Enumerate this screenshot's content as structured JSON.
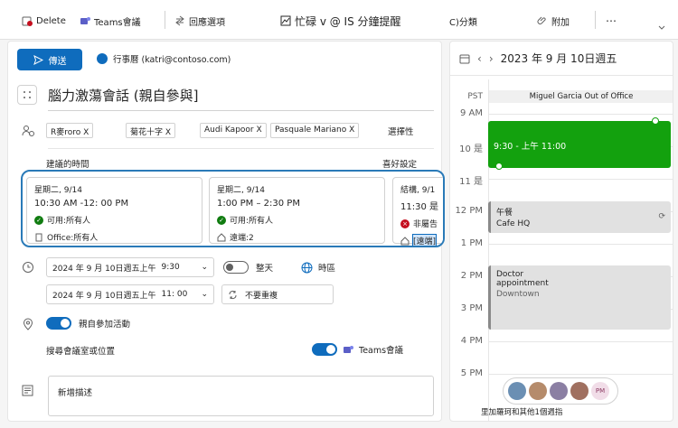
{
  "toolbar": {
    "delete_label": "Delete",
    "teams_label": "Teams會議",
    "response_label": "回應選項",
    "busy_label": "忙碌 v @ IS 分鐘提醒",
    "category_label": "C)分類",
    "attach_label": "附加"
  },
  "compose": {
    "send_label": "傳送",
    "from_text": "行事曆 (katri@contoso.com)",
    "title": "腦力激蕩會話 (親自參與]",
    "attendees": [
      "R麥roro X",
      "菊花十字 X",
      "Audi Kapoor X",
      "Pasquale Mariano X"
    ],
    "select_label": "選擇性",
    "suggested_label": "建議的時間",
    "preferences_label": "喜好設定"
  },
  "suggestions": [
    {
      "day": "星期二, 9/14",
      "time": "10:30 AM -12: 00 PM",
      "availability": "可用:所有人",
      "location": "Office:所有人"
    },
    {
      "day": "星期二, 9/14",
      "time": "1:00 PM – 2:30 PM",
      "availability": "可用:所有人",
      "location": "遠端:2"
    },
    {
      "day": "結構, 9/1",
      "time": "11:30 是",
      "availability": "非屬告",
      "location": "[遠端]"
    }
  ],
  "schedule": {
    "start_date": "2024 年 9 月 10日週五上午",
    "start_time": "9:30",
    "allday_label": "整天",
    "timezone_label": "時區",
    "end_date": "2024 年 9 月 10日週五上午",
    "end_time": "11: 00",
    "repeat_label": "不要重複",
    "inperson_label": "親自參加活動",
    "room_label": "搜尋會議室或位置",
    "teams_label": "Teams會議",
    "description_placeholder": "新增描述"
  },
  "calendar": {
    "date_label": "2023 年 9 月 10日週五",
    "timezone": "PST",
    "allday_event": "Miguel Garcia Out of Office",
    "hours": [
      "9 AM",
      "10 是",
      "11 是",
      "12 PM",
      "1 PM",
      "2 PM",
      "3 PM",
      "4 PM",
      "5 PM"
    ],
    "events": [
      {
        "title": "9:30 - 上午 11:00",
        "color": "#13a10e"
      },
      {
        "title": "午餐",
        "subtitle": "Cafe HQ",
        "color": "#e1e1e1"
      },
      {
        "title": "Doctor appointment",
        "subtitle": "Downtown",
        "color": "#e1e1e1"
      }
    ],
    "attendee_initials": "PM",
    "footer_text": "里加羅珂和其他1個週指"
  },
  "colors": {
    "accent": "#0f6cbd",
    "event_green": "#13a10e",
    "available": "#107c10",
    "unavailable": "#c50f1f"
  }
}
